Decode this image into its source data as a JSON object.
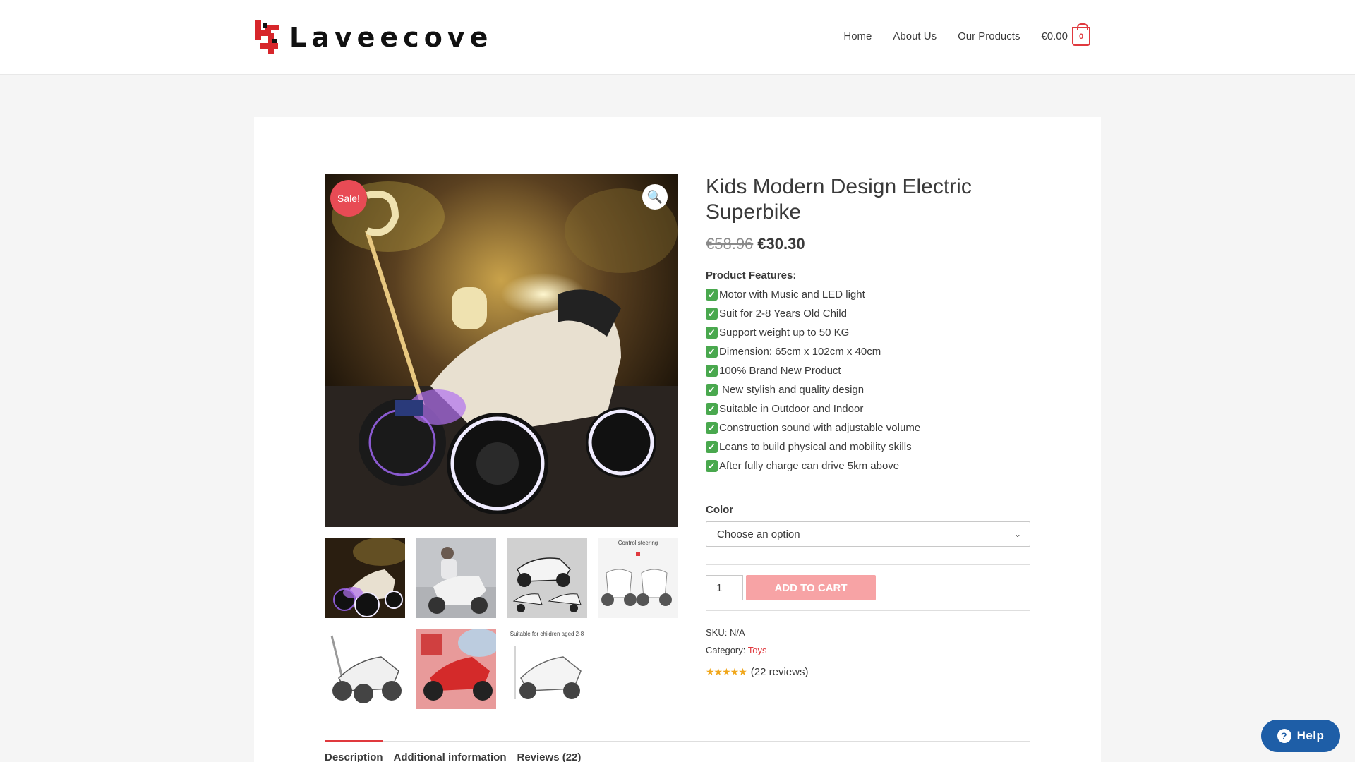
{
  "header": {
    "logo_text": "Laveecove",
    "nav": [
      "Home",
      "About Us",
      "Our Products"
    ],
    "cart_total": "€0.00",
    "cart_count": "0"
  },
  "gallery": {
    "sale_label": "Sale!",
    "thumb_captions": [
      "Control steering",
      "Suitable for children aged 2-8"
    ]
  },
  "product": {
    "title": "Kids Modern Design Electric Superbike",
    "old_price": "€58.96",
    "new_price": "€30.30",
    "features_heading": "Product Features:",
    "features": [
      "Motor with Music and LED light",
      "Suit for 2-8 Years Old Child",
      "Support weight up to 50 KG",
      "Dimension: 65cm x 102cm x 40cm",
      "100% Brand New Product",
      " New stylish and quality design",
      "Suitable in Outdoor and Indoor",
      "Construction sound with adjustable volume",
      "Leans to build physical and mobility skills",
      "After fully charge can drive 5km above"
    ],
    "color_label": "Color",
    "color_select": "Choose an option",
    "quantity": "1",
    "add_to_cart": "ADD TO CART",
    "sku_label": "SKU:",
    "sku_value": "N/A",
    "category_label": "Category:",
    "category_value": "Toys",
    "rating_value": 4.9,
    "reviews_text": "(22 reviews)"
  },
  "tabs": [
    "Description",
    "Additional information",
    "Reviews (22)"
  ],
  "help_label": "Help",
  "colors": {
    "accent": "#e0393e",
    "sale_badge": "#e84b55",
    "add_to_cart_bg": "#f7a3a5",
    "help_bg": "#1e5ea7",
    "star": "#f0a71c"
  }
}
